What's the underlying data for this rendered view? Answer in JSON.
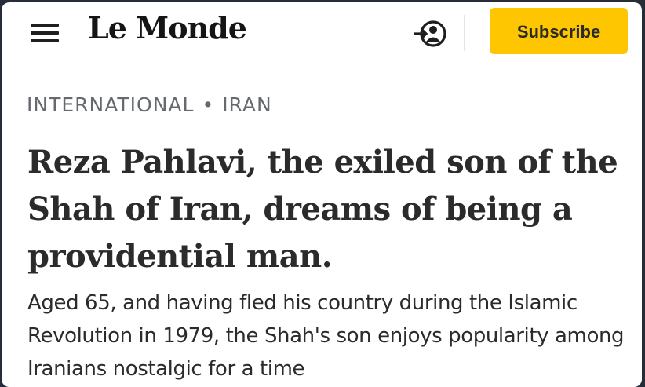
{
  "header": {
    "logo": "Le Monde",
    "subscribe_label": "Subscribe",
    "menu_icon": "hamburger-menu-icon",
    "login_icon": "user-login-icon",
    "accent_color": "#fdc600"
  },
  "article": {
    "section": "INTERNATIONAL",
    "separator": "•",
    "subsection": "IRAN",
    "headline": "Reza Pahlavi, the exiled son of the Shah of Iran, dreams of being a providential man.",
    "standfirst": "Aged 65, and having fled his country during the Islamic Revolution in 1979, the Shah's son enjoys popularity among Iranians nostalgic for a time"
  }
}
